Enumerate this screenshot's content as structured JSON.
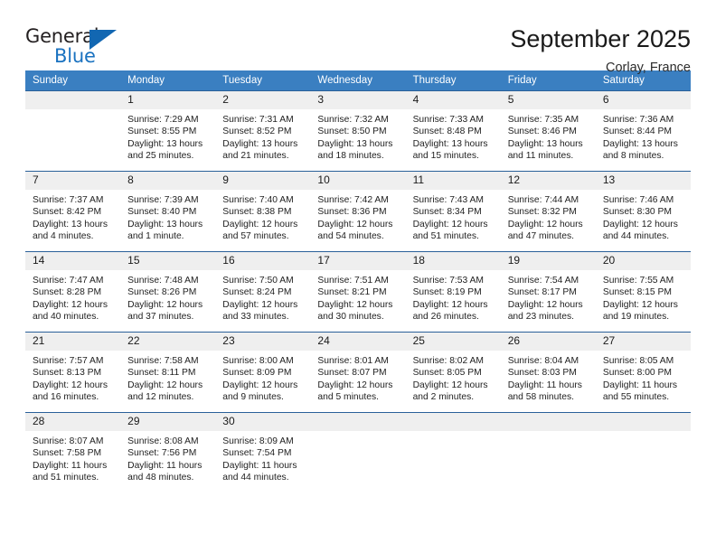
{
  "brand": {
    "name_part1": "General",
    "name_part2": "Blue",
    "triangle_color": "#1267b2"
  },
  "header": {
    "title": "September 2025",
    "location": "Corlay, France",
    "header_bg_color": "#3a7fc1",
    "daynum_bg_color": "#efefef"
  },
  "weekdays": [
    "Sunday",
    "Monday",
    "Tuesday",
    "Wednesday",
    "Thursday",
    "Friday",
    "Saturday"
  ],
  "weeks": [
    [
      {
        "day": "",
        "sunrise": "",
        "sunset": "",
        "daylight_line1": "",
        "daylight_line2": ""
      },
      {
        "day": "1",
        "sunrise": "Sunrise: 7:29 AM",
        "sunset": "Sunset: 8:55 PM",
        "daylight_line1": "Daylight: 13 hours",
        "daylight_line2": "and 25 minutes."
      },
      {
        "day": "2",
        "sunrise": "Sunrise: 7:31 AM",
        "sunset": "Sunset: 8:52 PM",
        "daylight_line1": "Daylight: 13 hours",
        "daylight_line2": "and 21 minutes."
      },
      {
        "day": "3",
        "sunrise": "Sunrise: 7:32 AM",
        "sunset": "Sunset: 8:50 PM",
        "daylight_line1": "Daylight: 13 hours",
        "daylight_line2": "and 18 minutes."
      },
      {
        "day": "4",
        "sunrise": "Sunrise: 7:33 AM",
        "sunset": "Sunset: 8:48 PM",
        "daylight_line1": "Daylight: 13 hours",
        "daylight_line2": "and 15 minutes."
      },
      {
        "day": "5",
        "sunrise": "Sunrise: 7:35 AM",
        "sunset": "Sunset: 8:46 PM",
        "daylight_line1": "Daylight: 13 hours",
        "daylight_line2": "and 11 minutes."
      },
      {
        "day": "6",
        "sunrise": "Sunrise: 7:36 AM",
        "sunset": "Sunset: 8:44 PM",
        "daylight_line1": "Daylight: 13 hours",
        "daylight_line2": "and 8 minutes."
      }
    ],
    [
      {
        "day": "7",
        "sunrise": "Sunrise: 7:37 AM",
        "sunset": "Sunset: 8:42 PM",
        "daylight_line1": "Daylight: 13 hours",
        "daylight_line2": "and 4 minutes."
      },
      {
        "day": "8",
        "sunrise": "Sunrise: 7:39 AM",
        "sunset": "Sunset: 8:40 PM",
        "daylight_line1": "Daylight: 13 hours",
        "daylight_line2": "and 1 minute."
      },
      {
        "day": "9",
        "sunrise": "Sunrise: 7:40 AM",
        "sunset": "Sunset: 8:38 PM",
        "daylight_line1": "Daylight: 12 hours",
        "daylight_line2": "and 57 minutes."
      },
      {
        "day": "10",
        "sunrise": "Sunrise: 7:42 AM",
        "sunset": "Sunset: 8:36 PM",
        "daylight_line1": "Daylight: 12 hours",
        "daylight_line2": "and 54 minutes."
      },
      {
        "day": "11",
        "sunrise": "Sunrise: 7:43 AM",
        "sunset": "Sunset: 8:34 PM",
        "daylight_line1": "Daylight: 12 hours",
        "daylight_line2": "and 51 minutes."
      },
      {
        "day": "12",
        "sunrise": "Sunrise: 7:44 AM",
        "sunset": "Sunset: 8:32 PM",
        "daylight_line1": "Daylight: 12 hours",
        "daylight_line2": "and 47 minutes."
      },
      {
        "day": "13",
        "sunrise": "Sunrise: 7:46 AM",
        "sunset": "Sunset: 8:30 PM",
        "daylight_line1": "Daylight: 12 hours",
        "daylight_line2": "and 44 minutes."
      }
    ],
    [
      {
        "day": "14",
        "sunrise": "Sunrise: 7:47 AM",
        "sunset": "Sunset: 8:28 PM",
        "daylight_line1": "Daylight: 12 hours",
        "daylight_line2": "and 40 minutes."
      },
      {
        "day": "15",
        "sunrise": "Sunrise: 7:48 AM",
        "sunset": "Sunset: 8:26 PM",
        "daylight_line1": "Daylight: 12 hours",
        "daylight_line2": "and 37 minutes."
      },
      {
        "day": "16",
        "sunrise": "Sunrise: 7:50 AM",
        "sunset": "Sunset: 8:24 PM",
        "daylight_line1": "Daylight: 12 hours",
        "daylight_line2": "and 33 minutes."
      },
      {
        "day": "17",
        "sunrise": "Sunrise: 7:51 AM",
        "sunset": "Sunset: 8:21 PM",
        "daylight_line1": "Daylight: 12 hours",
        "daylight_line2": "and 30 minutes."
      },
      {
        "day": "18",
        "sunrise": "Sunrise: 7:53 AM",
        "sunset": "Sunset: 8:19 PM",
        "daylight_line1": "Daylight: 12 hours",
        "daylight_line2": "and 26 minutes."
      },
      {
        "day": "19",
        "sunrise": "Sunrise: 7:54 AM",
        "sunset": "Sunset: 8:17 PM",
        "daylight_line1": "Daylight: 12 hours",
        "daylight_line2": "and 23 minutes."
      },
      {
        "day": "20",
        "sunrise": "Sunrise: 7:55 AM",
        "sunset": "Sunset: 8:15 PM",
        "daylight_line1": "Daylight: 12 hours",
        "daylight_line2": "and 19 minutes."
      }
    ],
    [
      {
        "day": "21",
        "sunrise": "Sunrise: 7:57 AM",
        "sunset": "Sunset: 8:13 PM",
        "daylight_line1": "Daylight: 12 hours",
        "daylight_line2": "and 16 minutes."
      },
      {
        "day": "22",
        "sunrise": "Sunrise: 7:58 AM",
        "sunset": "Sunset: 8:11 PM",
        "daylight_line1": "Daylight: 12 hours",
        "daylight_line2": "and 12 minutes."
      },
      {
        "day": "23",
        "sunrise": "Sunrise: 8:00 AM",
        "sunset": "Sunset: 8:09 PM",
        "daylight_line1": "Daylight: 12 hours",
        "daylight_line2": "and 9 minutes."
      },
      {
        "day": "24",
        "sunrise": "Sunrise: 8:01 AM",
        "sunset": "Sunset: 8:07 PM",
        "daylight_line1": "Daylight: 12 hours",
        "daylight_line2": "and 5 minutes."
      },
      {
        "day": "25",
        "sunrise": "Sunrise: 8:02 AM",
        "sunset": "Sunset: 8:05 PM",
        "daylight_line1": "Daylight: 12 hours",
        "daylight_line2": "and 2 minutes."
      },
      {
        "day": "26",
        "sunrise": "Sunrise: 8:04 AM",
        "sunset": "Sunset: 8:03 PM",
        "daylight_line1": "Daylight: 11 hours",
        "daylight_line2": "and 58 minutes."
      },
      {
        "day": "27",
        "sunrise": "Sunrise: 8:05 AM",
        "sunset": "Sunset: 8:00 PM",
        "daylight_line1": "Daylight: 11 hours",
        "daylight_line2": "and 55 minutes."
      }
    ],
    [
      {
        "day": "28",
        "sunrise": "Sunrise: 8:07 AM",
        "sunset": "Sunset: 7:58 PM",
        "daylight_line1": "Daylight: 11 hours",
        "daylight_line2": "and 51 minutes."
      },
      {
        "day": "29",
        "sunrise": "Sunrise: 8:08 AM",
        "sunset": "Sunset: 7:56 PM",
        "daylight_line1": "Daylight: 11 hours",
        "daylight_line2": "and 48 minutes."
      },
      {
        "day": "30",
        "sunrise": "Sunrise: 8:09 AM",
        "sunset": "Sunset: 7:54 PM",
        "daylight_line1": "Daylight: 11 hours",
        "daylight_line2": "and 44 minutes."
      },
      {
        "day": "",
        "sunrise": "",
        "sunset": "",
        "daylight_line1": "",
        "daylight_line2": ""
      },
      {
        "day": "",
        "sunrise": "",
        "sunset": "",
        "daylight_line1": "",
        "daylight_line2": ""
      },
      {
        "day": "",
        "sunrise": "",
        "sunset": "",
        "daylight_line1": "",
        "daylight_line2": ""
      },
      {
        "day": "",
        "sunrise": "",
        "sunset": "",
        "daylight_line1": "",
        "daylight_line2": ""
      }
    ]
  ]
}
